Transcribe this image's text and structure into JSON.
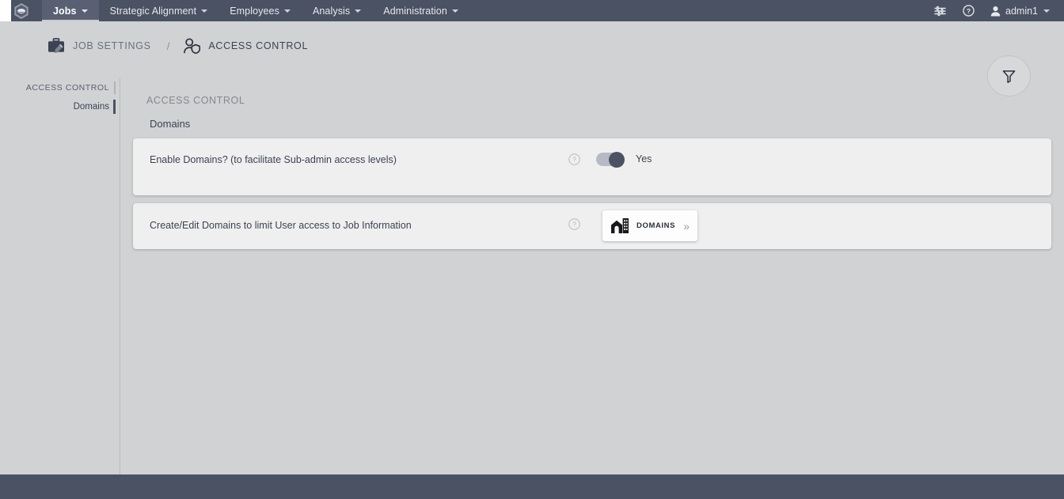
{
  "navbar": {
    "logo_icon": "hexagon-logo-icon",
    "items": [
      {
        "label": "Jobs",
        "active": true,
        "icon": "chevron-down-icon"
      },
      {
        "label": "Strategic Alignment",
        "active": false,
        "icon": "chevron-down-icon"
      },
      {
        "label": "Employees",
        "active": false,
        "icon": "chevron-down-icon"
      },
      {
        "label": "Analysis",
        "active": false,
        "icon": "chevron-down-icon"
      },
      {
        "label": "Administration",
        "active": false,
        "icon": "chevron-down-icon"
      }
    ],
    "right": {
      "settings_icon": "sliders-icon",
      "help_icon": "question-circle-icon",
      "user_icon": "user-avatar-icon",
      "username": "admin1",
      "user_caret_icon": "chevron-down-icon"
    },
    "background_color": "#4b5263"
  },
  "breadcrumb": {
    "parent": {
      "label": "JOB SETTINGS",
      "icon": "briefcase-edit-icon"
    },
    "separator": "/",
    "current": {
      "label": "ACCESS CONTROL",
      "icon": "user-shield-icon"
    }
  },
  "filter_button": {
    "name": "filter-button",
    "icon": "funnel-icon"
  },
  "sidebar": {
    "heading": "ACCESS CONTROL",
    "items": [
      {
        "label": "Domains",
        "active": true
      }
    ]
  },
  "main": {
    "section_title": "ACCESS CONTROL",
    "section_subtitle": "Domains",
    "settings": [
      {
        "label": "Enable Domains? (to facilitate Sub-admin access levels)",
        "help_icon": "question-circle-icon",
        "control": "toggle",
        "toggle_on": true,
        "value_text": "Yes"
      },
      {
        "label": "Create/Edit Domains to limit User access to Job Information",
        "help_icon": "question-circle-icon",
        "control": "button",
        "button_label": "DOMAINS",
        "button_icon": "building-home-icon",
        "button_chevron": "»"
      }
    ]
  },
  "theme": {
    "page_background": "#d0d2d4",
    "navbar_background": "#4b5263",
    "card_background": "#efefef",
    "accent_dark": "#4b5263",
    "text_primary": "#3c4352",
    "text_muted": "#85898f"
  }
}
